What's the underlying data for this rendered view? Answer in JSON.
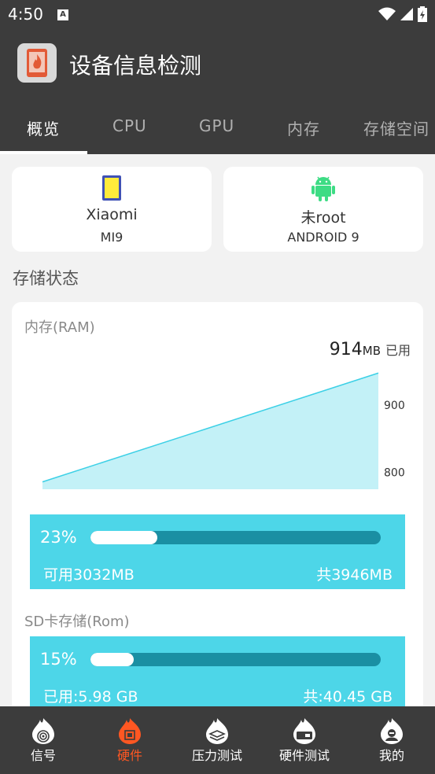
{
  "status_bar": {
    "time": "4:50",
    "notification_glyph": "A"
  },
  "app": {
    "title": "设备信息检测",
    "icon": "phone-flame-icon"
  },
  "tabs": [
    {
      "label": "概览",
      "active": true
    },
    {
      "label": "CPU",
      "active": false
    },
    {
      "label": "GPU",
      "active": false
    },
    {
      "label": "内存",
      "active": false
    },
    {
      "label": "存储空间",
      "active": false
    }
  ],
  "device_cards": [
    {
      "name": "Xiaomi",
      "sub": "MI9",
      "icon": "phone-icon"
    },
    {
      "name": "未root",
      "sub": "ANDROID 9",
      "icon": "android-icon"
    }
  ],
  "storage": {
    "section_title": "存储状态",
    "ram": {
      "label": "内存(RAM)",
      "used_value": "914",
      "used_unit": "MB",
      "used_label": "已用",
      "percent_text": "23%",
      "percent": 0.23,
      "available": "可用3032MB",
      "total": "共3946MB"
    },
    "rom": {
      "label": "SD卡存储(Rom)",
      "percent_text": "15%",
      "percent": 0.15,
      "used": "已用:5.98 GB",
      "total": "共:40.45 GB"
    }
  },
  "chart_data": {
    "type": "area",
    "y_tick_labels": [
      "900",
      "800"
    ],
    "y_ticks": [
      900,
      800
    ],
    "ylim": [
      775,
      960
    ],
    "x": [
      0,
      1
    ],
    "values": [
      786,
      948
    ],
    "grid": false,
    "fill_color": "#c3f1f7",
    "line_color": "#3cd0e6"
  },
  "bottom_nav": [
    {
      "label": "信号",
      "icon": "signal-flame-icon",
      "active": false
    },
    {
      "label": "硬件",
      "icon": "chip-flame-icon",
      "active": true
    },
    {
      "label": "压力测试",
      "icon": "layers-flame-icon",
      "active": false
    },
    {
      "label": "硬件测试",
      "icon": "card-flame-icon",
      "active": false
    },
    {
      "label": "我的",
      "icon": "user-flame-icon",
      "active": false
    }
  ],
  "colors": {
    "accent": "#4dd6e8",
    "active_nav": "#ff5722",
    "bar_dark": "#3c3c3c"
  }
}
